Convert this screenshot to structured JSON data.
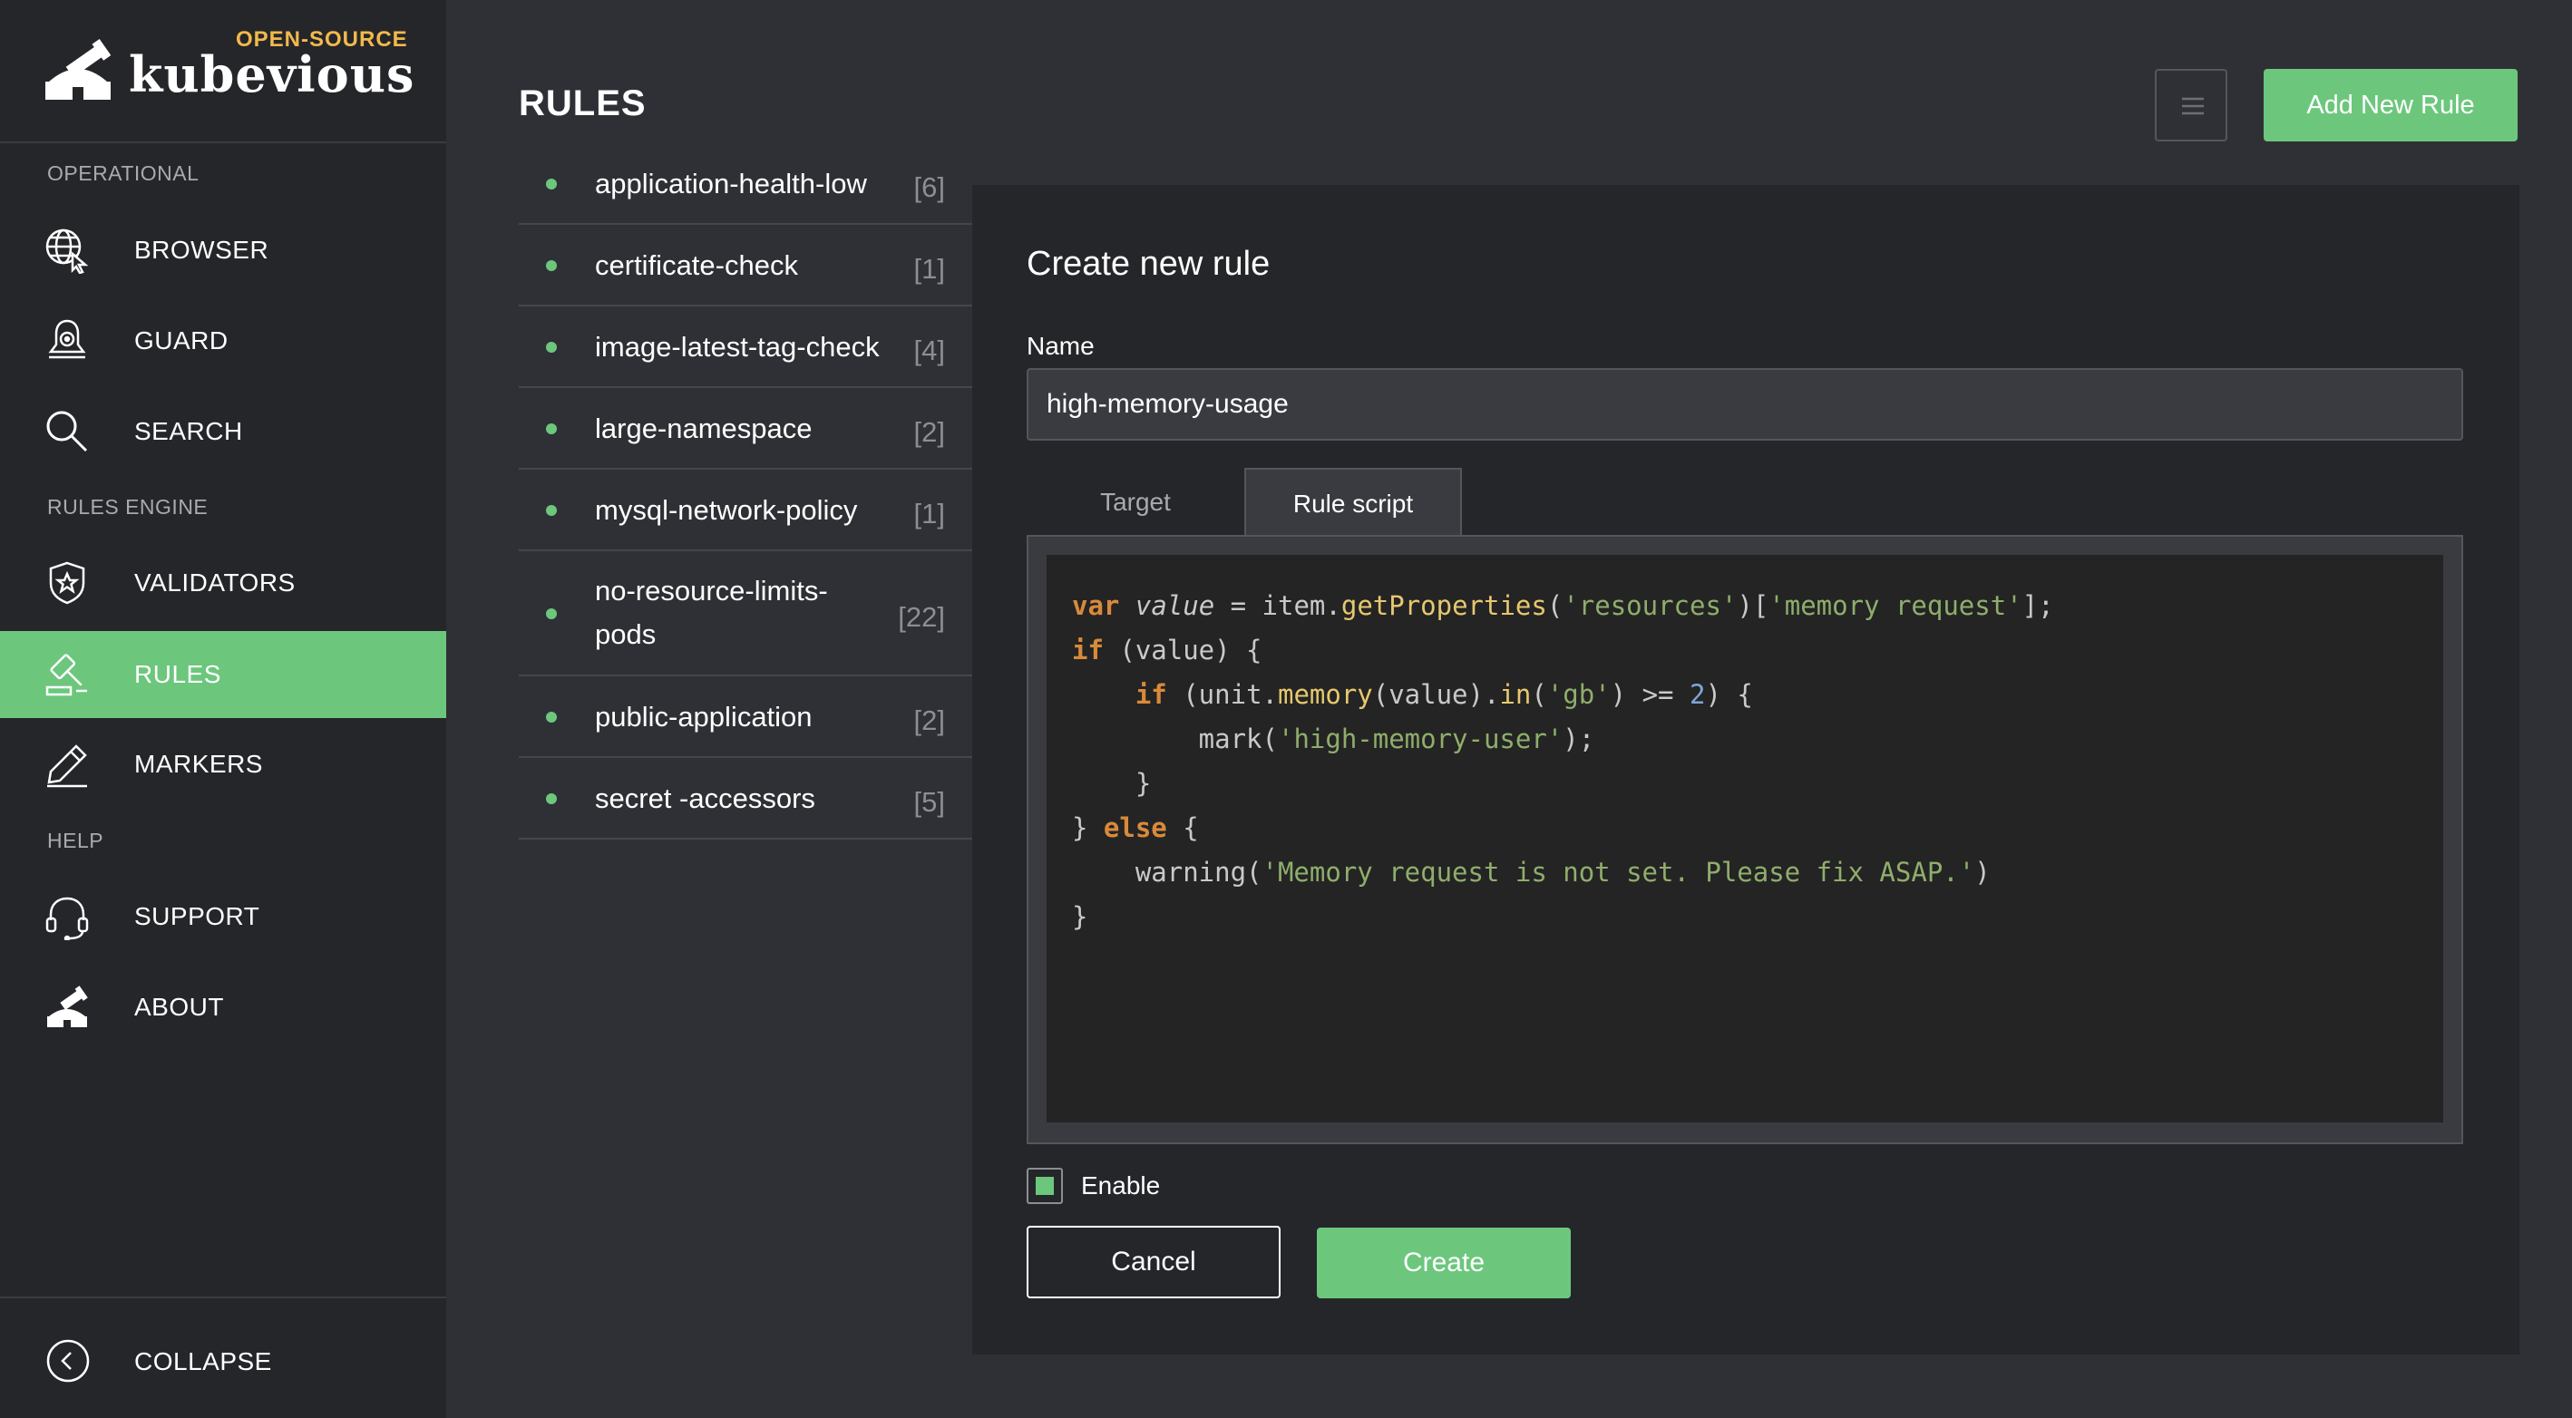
{
  "brand": {
    "tagline": "OPEN-SOURCE",
    "name": "kubevious"
  },
  "sidebar": {
    "sections": [
      "OPERATIONAL",
      "RULES ENGINE",
      "HELP"
    ],
    "items": [
      {
        "label": "BROWSER",
        "icon": "globe-cursor-icon"
      },
      {
        "label": "GUARD",
        "icon": "shield-bell-icon"
      },
      {
        "label": "SEARCH",
        "icon": "search-icon"
      },
      {
        "label": "VALIDATORS",
        "icon": "shield-star-icon"
      },
      {
        "label": "RULES",
        "icon": "gavel-icon",
        "active": true
      },
      {
        "label": "MARKERS",
        "icon": "pen-icon"
      },
      {
        "label": "SUPPORT",
        "icon": "headset-icon"
      },
      {
        "label": "ABOUT",
        "icon": "telescope-icon"
      }
    ],
    "collapse_label": "COLLAPSE"
  },
  "header": {
    "title": "RULES",
    "add_label": "Add New Rule"
  },
  "rules": [
    {
      "name": "application-health-low",
      "count": "[6]"
    },
    {
      "name": "certificate-check",
      "count": "[1]"
    },
    {
      "name": "image-latest-tag-check",
      "count": "[4]"
    },
    {
      "name": "large-namespace",
      "count": "[2]"
    },
    {
      "name": "mysql-network-policy",
      "count": "[1]"
    },
    {
      "name": "no-resource-limits-pods",
      "name_line1": "no-resource-limits-",
      "name_line2": "pods",
      "count": "[22]"
    },
    {
      "name": "public-application",
      "count": "[2]"
    },
    {
      "name": "secret -accessors",
      "count": "[5]"
    }
  ],
  "form": {
    "title": "Create new rule",
    "name_label": "Name",
    "name_value": "high-memory-usage",
    "tabs": [
      "Target",
      "Rule script"
    ],
    "active_tab": "Rule script",
    "code": {
      "l1": {
        "kw": "var",
        "var": "value",
        "eq": " = item.",
        "fn": "getProperties",
        "p1": "(",
        "s1": "'resources'",
        "p2": ")[",
        "s2": "'memory request'",
        "p3": "];"
      },
      "l2": {
        "kw": "if",
        "rest": " (value) {"
      },
      "l3": {
        "indent": "    ",
        "kw": "if",
        "p1": " (unit.",
        "fn1": "memory",
        "p2": "(value).",
        "fn2": "in",
        "p3": "(",
        "s1": "'gb'",
        "p4": ") >= ",
        "num": "2",
        "p5": ") {"
      },
      "l4": {
        "pre": "        mark(",
        "s1": "'high-memory-user'",
        "post": ");"
      },
      "l5": {
        "text": "    }"
      },
      "l6": {
        "pre": "} ",
        "kw": "else",
        "post": " {"
      },
      "l7": {
        "pre": "    warning(",
        "s1": "'Memory request is not set. Please fix ASAP.'",
        "post": ")"
      },
      "l8": {
        "text": "}"
      }
    },
    "enable_label": "Enable",
    "enabled": true,
    "cancel_label": "Cancel",
    "create_label": "Create"
  },
  "colors": {
    "accent": "#6cc77d",
    "brand_tagline": "#f2b94b",
    "sidebar_bg": "#25262a",
    "main_bg": "#2f3035"
  }
}
